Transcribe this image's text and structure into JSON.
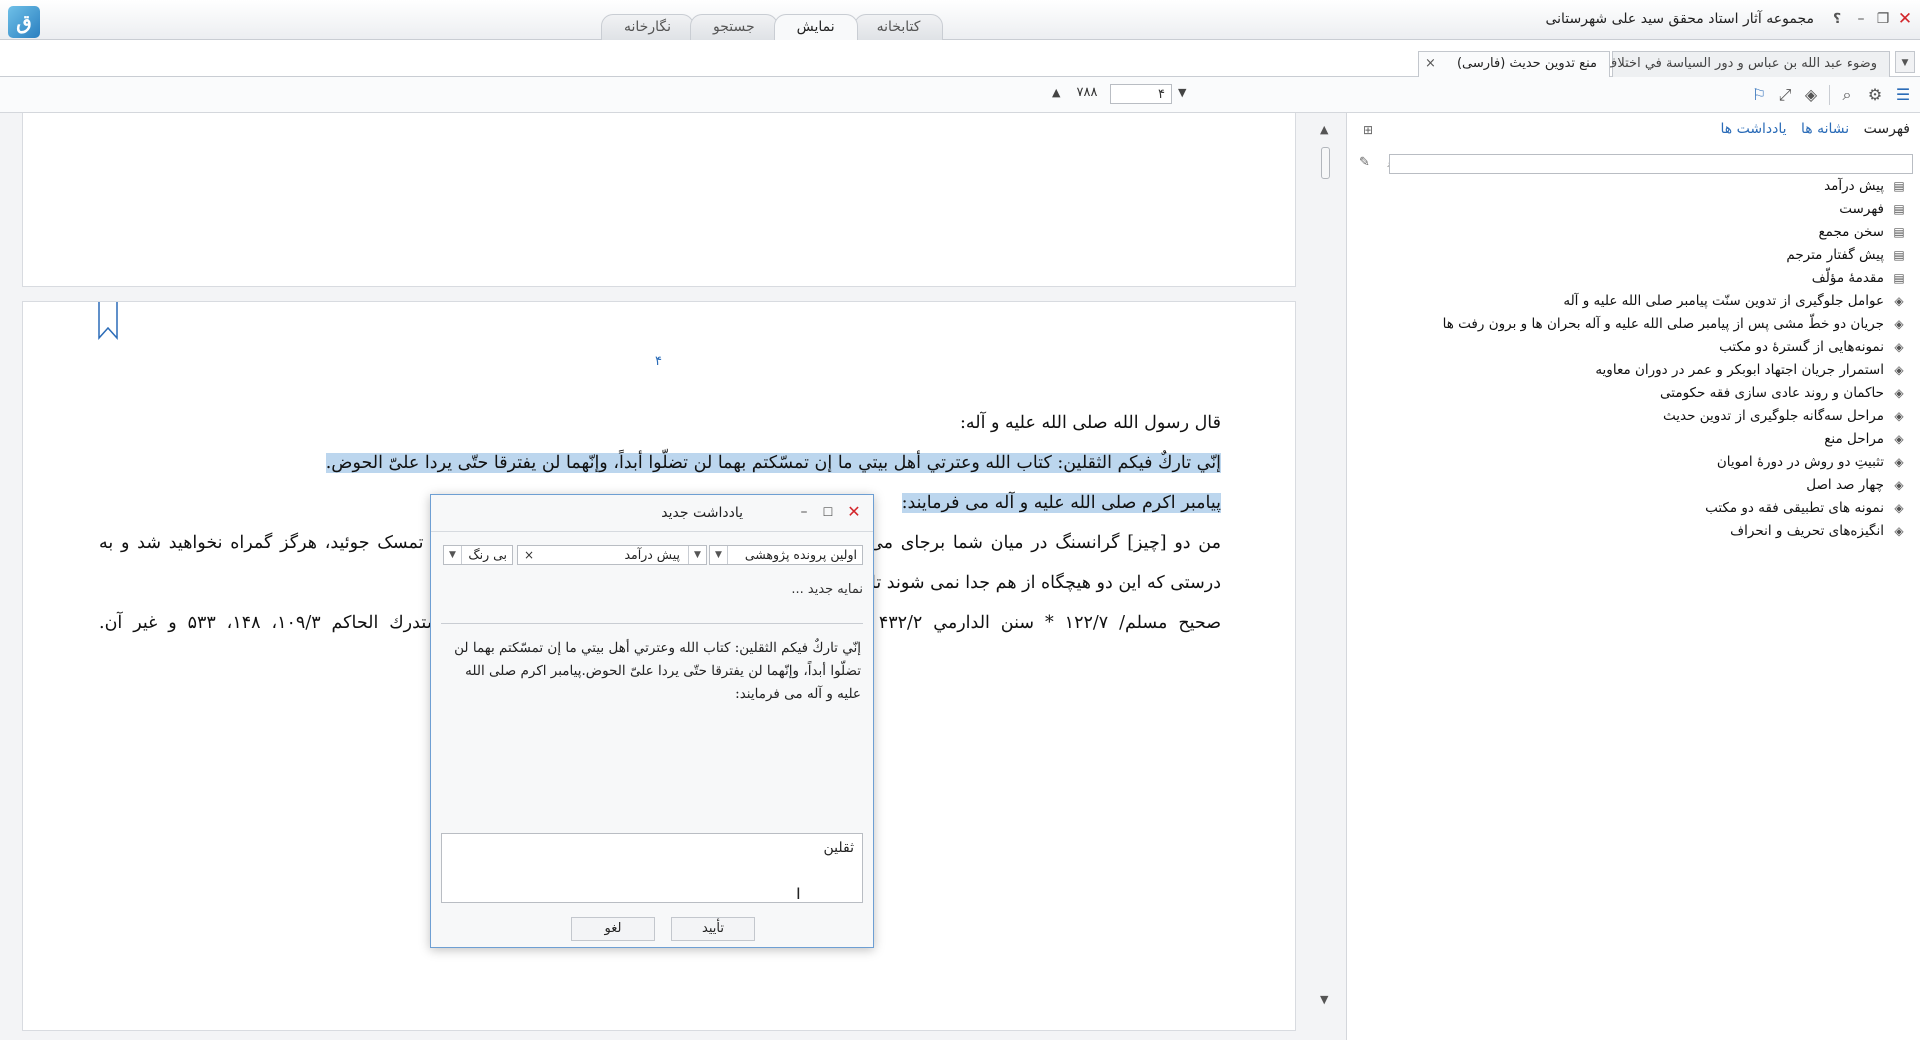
{
  "app": {
    "title": "مجموعه آثار استاد محقق سید علی شهرستانی",
    "logo_text": "ق"
  },
  "window_controls": {
    "help": "؟",
    "minimize": "–",
    "restore": "❐",
    "close": "✕"
  },
  "main_tabs": [
    {
      "label": "کتابخانه",
      "active": false
    },
    {
      "label": "نمایش",
      "active": true
    },
    {
      "label": "جستجو",
      "active": false
    },
    {
      "label": "نگارخانه",
      "active": false
    }
  ],
  "doc_tabs": [
    {
      "label": "وضوء عبد الله بن عباس و دور السياسة في اختلاف النقل عنه",
      "active": false
    },
    {
      "label": "منع تدوین حدیث (فارسی)",
      "active": true,
      "close": "×"
    }
  ],
  "toolbar": {
    "page_input": "۴",
    "page_total": "۷۸۸",
    "nav_up": "▲",
    "nav_down": "▼"
  },
  "document": {
    "page_number": "۴",
    "lines": [
      "قال رسول الله صلى الله عليه و آله:",
      "إنّي تاركٌ فيكم الثقلين: كتاب الله وعترتي أهل بيتي ما إن تمسّكتم بهما لن تضلّوا أبداً، وإنّهما لن يفترقا حتّى يردا علىّ الحوض.",
      "پیامبر اکرم صلى الله علیه و آله مى فرمایند:",
      "من دو [چیز] گرانسنگ در میان شما برجای مى نهم: کتاب خدا و عترتم، اهل بیتم را؛ مادامى که به آن دو تمسک جوئید، هرگز گمراه نخواهید شد و به",
      "درستى که این دو هیچگاه از هم جدا نمى شوند تا آنکه در کنار حوض بر من وارد شوند.",
      "صحیح مسلم/ ۱۲۲/۷ * سنن الدارمي ۴۳۲/۲ * مسند أحمد ۱۴/۳، ۱۷، ۲۶، ۵۹ و ۳۶۶/۴، ۳۷۱ * المستدرك الحاكم ۱۰۹/۳، ۱۴۸، ۵۳۳ و غیر آن."
    ]
  },
  "sidebar": {
    "tabs": [
      {
        "label": "فهرست",
        "active": true
      },
      {
        "label": "نشانه ها",
        "active": false
      },
      {
        "label": "یادداشت ها",
        "active": false
      }
    ],
    "search_placeholder": "",
    "toc": [
      {
        "label": "پیش درآمد",
        "icon": "page-icon"
      },
      {
        "label": "فهرست",
        "icon": "page-icon"
      },
      {
        "label": "سخن مجمع",
        "icon": "page-icon"
      },
      {
        "label": "پیش گفتار مترجم",
        "icon": "page-icon"
      },
      {
        "label": "مقدمهٔ مؤلّف",
        "icon": "page-icon"
      },
      {
        "label": "عوامل جلوگیری از تدوین سنّت پیامبر صلى الله علیه و آله",
        "icon": "chapter-icon"
      },
      {
        "label": "جریان دو خطّ مشى پس از پیامبر صلى الله علیه و آله بحران ها و برون رفت ها",
        "icon": "chapter-icon"
      },
      {
        "label": "نمونه‌هایی از گسترهٔ دو مکتب",
        "icon": "chapter-icon"
      },
      {
        "label": "استمرار جریان اجتهاد ابوبکر و عمر در دوران معاویه",
        "icon": "chapter-icon"
      },
      {
        "label": "حاکمان و روند عادی سازی فقه حکومتی",
        "icon": "chapter-icon"
      },
      {
        "label": "مراحل سه‌گانه جلوگیری از تدوین حدیث",
        "icon": "chapter-icon"
      },
      {
        "label": "مراحل منع",
        "icon": "chapter-icon"
      },
      {
        "label": "تثبیتِ دو روش در دورهٔ امویان",
        "icon": "chapter-icon"
      },
      {
        "label": "چهار صد اصل",
        "icon": "chapter-icon"
      },
      {
        "label": "نمونه های تطبیقی فقه دو مکتب",
        "icon": "chapter-icon"
      },
      {
        "label": "انگیزه‌های تحریف و انحراف",
        "icon": "chapter-icon"
      }
    ]
  },
  "dialog": {
    "title": "یادداشت جدید",
    "folder_select": "اولین پرونده پژوهشی",
    "heading_select": "پیش درآمد",
    "heading_clear": "×",
    "color_select": "بی رنگ",
    "index_placeholder": "نمایه جدید ...",
    "quote": "إنّي تاركٌ فيكم الثقلين: كتاب الله وعترتي أهل بيتي ما إن تمسّكتم بهما لن تضلّوا أبداً، وإنّهما لن يفترقا حتّى يردا علىّ الحوض.پیامبر اکرم صلى الله علیه و آله مى فرمایند:",
    "note_value": "ثقلین",
    "ok_label": "تأیید",
    "cancel_label": "لغو"
  },
  "colors": {
    "accent": "#2b6cb8",
    "selection": "#bcd6ee",
    "close_red": "#d3262b",
    "dialog_border": "#6e9fd3"
  }
}
